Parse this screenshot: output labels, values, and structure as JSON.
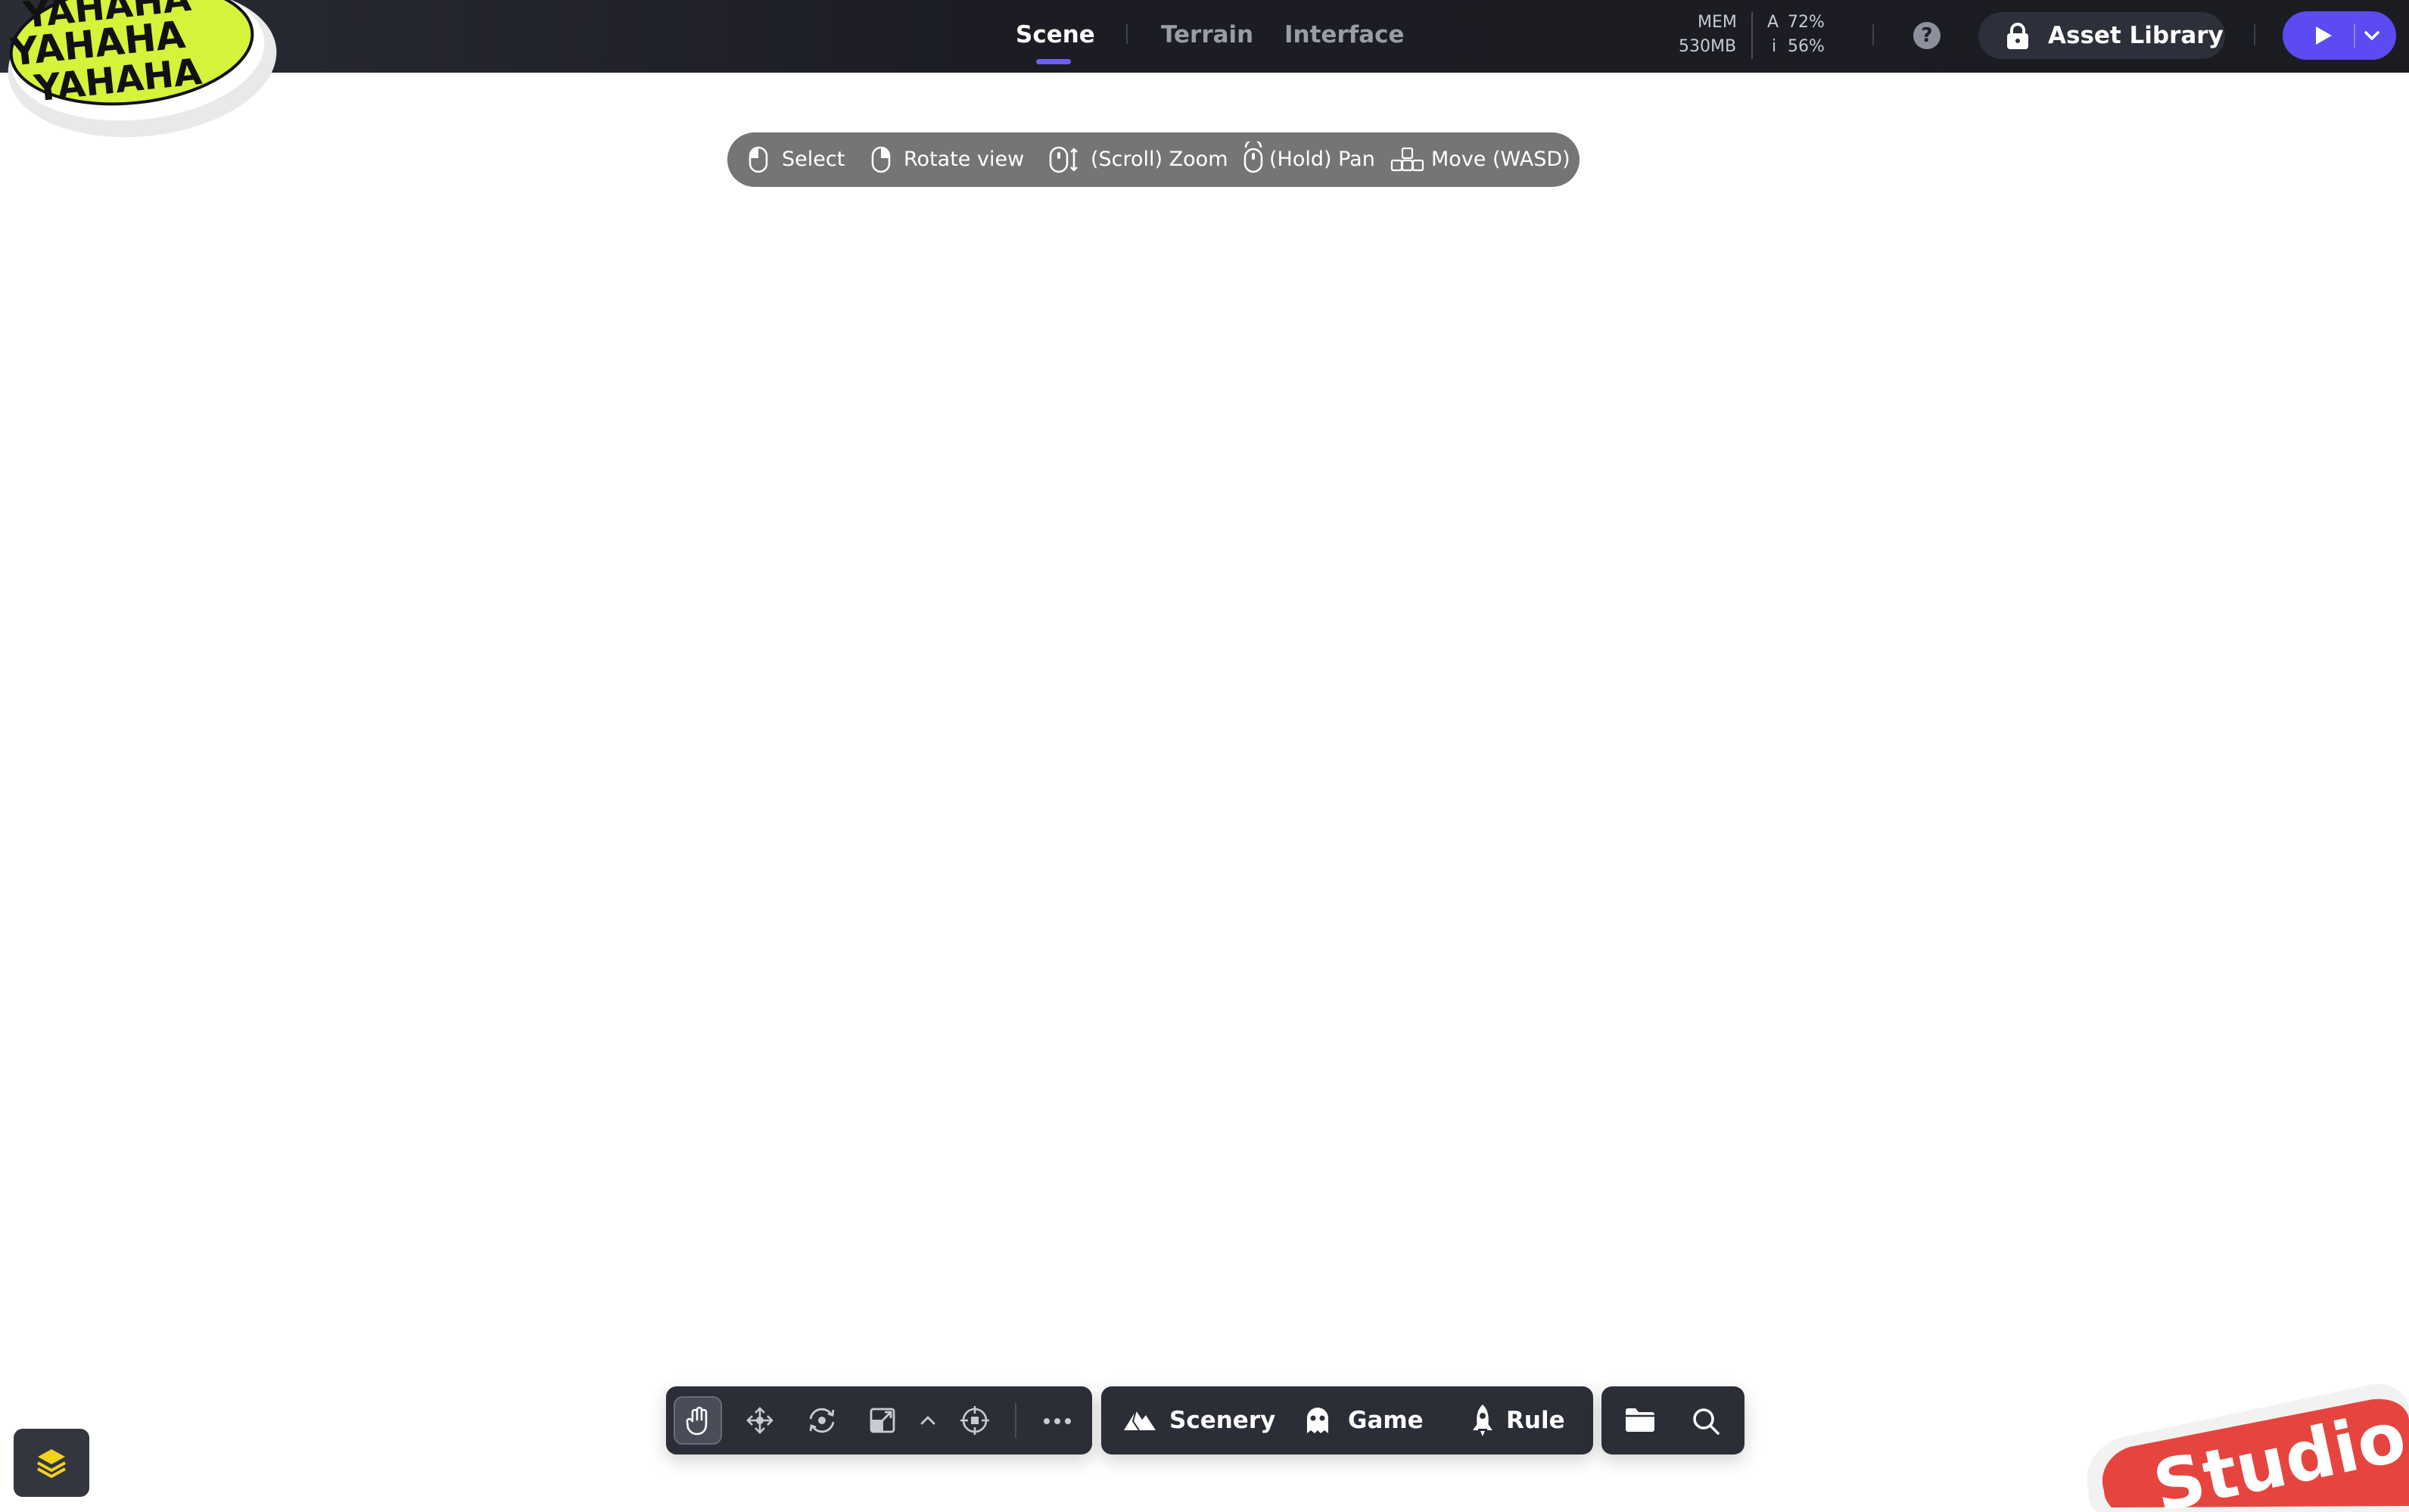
{
  "topbar": {
    "tabs": [
      {
        "label": "Scene",
        "active": true
      },
      {
        "label": "Terrain",
        "active": false
      },
      {
        "label": "Interface",
        "active": false
      }
    ],
    "stats": {
      "mem_label": "MEM",
      "mem_value": "530MB",
      "a_label": "A",
      "a_value": "72%",
      "i_label": "i",
      "i_value": "56%"
    },
    "help_icon": "question-circle-icon",
    "asset_library_label": "Asset Library",
    "play_icon": "play-icon",
    "accent_color": "#6d5dfc"
  },
  "logo": {
    "text": "YAHAHA",
    "color": "#d6f23a"
  },
  "hints": [
    {
      "icon": "mouse-left-icon",
      "label": "Select"
    },
    {
      "icon": "mouse-right-icon",
      "label": "Rotate view"
    },
    {
      "icon": "mouse-scroll-icon",
      "label": "(Scroll) Zoom"
    },
    {
      "icon": "mouse-middle-icon",
      "label": "(Hold) Pan"
    },
    {
      "icon": "wasd-keys-icon",
      "label": "Move (WASD)"
    }
  ],
  "toolbar": {
    "tools": [
      "hand-tool-icon",
      "move-tool-icon",
      "rotate-tool-icon",
      "scale-tool-icon",
      "chevron-up-icon",
      "pivot-tool-icon",
      "more-icon"
    ],
    "active_tool": "hand-tool-icon",
    "create": [
      {
        "icon": "scenery-icon",
        "label": "Scenery"
      },
      {
        "icon": "game-icon",
        "label": "Game"
      },
      {
        "icon": "rule-icon",
        "label": "Rule"
      }
    ],
    "file_icons": [
      "folder-icon",
      "search-icon"
    ]
  },
  "layers_button": {
    "icon": "layers-icon",
    "color": "#f2d21b"
  },
  "studio_sticker": {
    "text": "Studio",
    "color": "#e6453f"
  }
}
